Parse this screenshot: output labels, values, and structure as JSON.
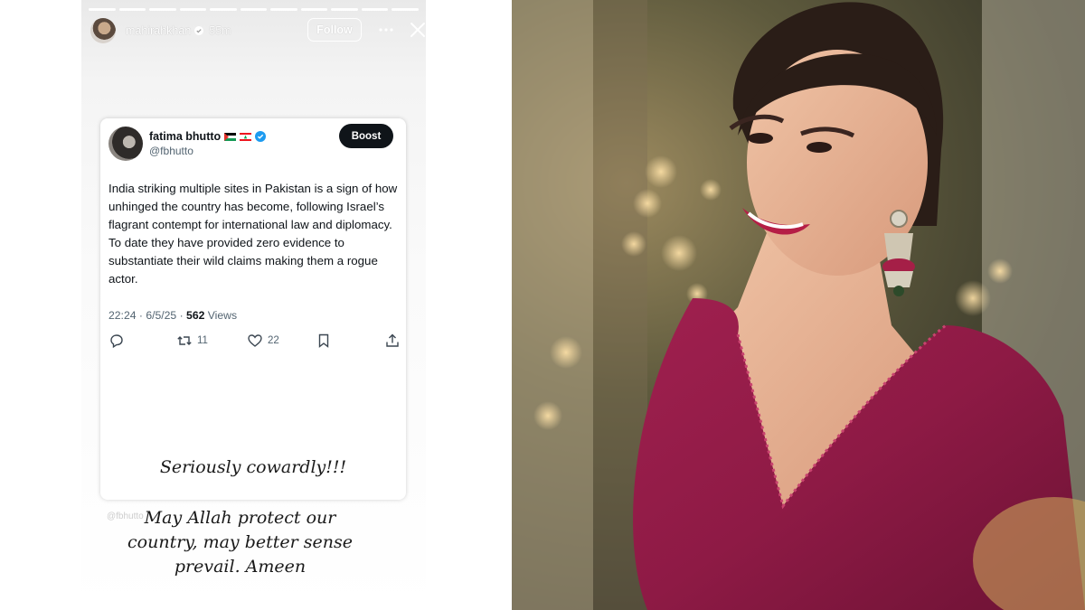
{
  "story": {
    "username": "mahirahkhan",
    "time": "55m",
    "follow_label": "Follow",
    "progress_segments": 11,
    "progress_active": 11
  },
  "tweet": {
    "name": "fatima bhutto",
    "handle": "@fbhutto",
    "boost_label": "Boost",
    "body": "India striking multiple sites in Pakistan is a sign of how unhinged the country has become, following Israel’s flagrant contempt for international law and diplomacy. To date they have provided zero evidence to substantiate their wild claims making them a rogue actor.",
    "time_date": "22:24 · 6/5/25 · ",
    "views_count": "562",
    "views_label": " Views",
    "retweets": "11",
    "likes": "22"
  },
  "overlay_text": {
    "line1": "Seriously cowardly!!!",
    "line2": "May Allah protect our country, may better sense prevail. Ameen",
    "watermark": "@fbhutto"
  },
  "colors": {
    "verified_blue": "#1d9bf0",
    "boost_bg": "#0f1419",
    "saree_magenta": "#8e1a45"
  },
  "icons": [
    "verified-badge-icon",
    "more-icon",
    "close-icon",
    "palestine-flag-icon",
    "lebanon-flag-icon",
    "reply-icon",
    "retweet-icon",
    "like-icon",
    "bookmark-icon",
    "share-icon"
  ]
}
